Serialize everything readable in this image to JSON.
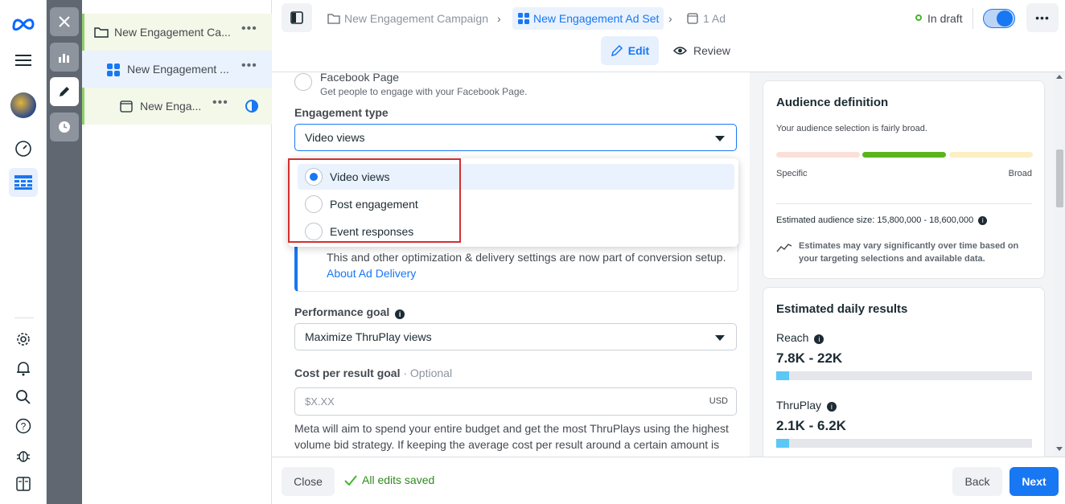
{
  "nav": {
    "icons": [
      "meta-logo-icon",
      "menu-icon",
      "avatar",
      "dashboard-icon",
      "table-icon",
      "gear-icon",
      "bell-icon",
      "search-icon",
      "help-icon",
      "bug-icon",
      "panel-icon"
    ]
  },
  "tree": {
    "campaign": "New Engagement Ca...",
    "adset": "New Engagement ...",
    "ad": "New Enga..."
  },
  "breadcrumb": {
    "campaign": "New Engagement Campaign",
    "adset": "New Engagement Ad Set",
    "ad": "1 Ad"
  },
  "status": {
    "label": "In draft"
  },
  "modes": {
    "edit": "Edit",
    "review": "Review"
  },
  "form": {
    "facebook_page_title": "Facebook Page",
    "facebook_page_desc": "Get people to engage with your Facebook Page.",
    "engagement_type_label": "Engagement type",
    "engagement_type_value": "Video views",
    "engagement_options": [
      "Video views",
      "Post engagement",
      "Event responses"
    ],
    "info_text": "This and other optimization & delivery settings are now part of conversion setup.",
    "info_link": "About Ad Delivery",
    "performance_goal_label": "Performance goal",
    "performance_goal_value": "Maximize ThruPlay views",
    "cost_goal_label": "Cost per result goal",
    "cost_goal_optional": "· Optional",
    "cost_placeholder": "$X.XX",
    "currency": "USD",
    "bid_text_1": "Meta will aim to spend your entire budget and get the most ThruPlays using the highest",
    "bid_text_2": "volume bid strategy. If keeping the average cost per result around a certain amount is"
  },
  "audience": {
    "title": "Audience definition",
    "subtitle": "Your audience selection is fairly broad.",
    "specific": "Specific",
    "broad": "Broad",
    "size": "Estimated audience size: 15,800,000 - 18,600,000",
    "note": "Estimates may vary significantly over time based on your targeting selections and available data."
  },
  "results": {
    "title": "Estimated daily results",
    "reach_label": "Reach",
    "reach_value": "7.8K - 22K",
    "reach_fill": 0.05,
    "thruplay_label": "ThruPlay",
    "thruplay_value": "2.1K - 6.2K",
    "thruplay_fill": 0.05
  },
  "footer": {
    "close": "Close",
    "saved": "All edits saved",
    "back": "Back",
    "next": "Next"
  },
  "colors": {
    "accent": "#1877f2",
    "green": "#42b72a",
    "highlight": "#d32f2f"
  }
}
